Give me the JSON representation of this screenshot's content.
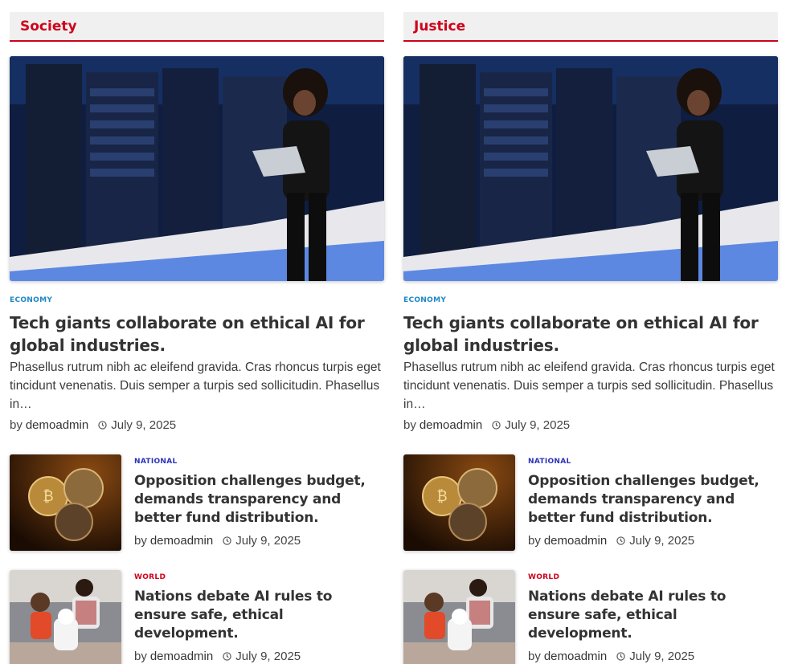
{
  "columns": [
    {
      "section_title": "Society",
      "featured": {
        "category": "ECONOMY",
        "title": "Tech giants collaborate on ethical AI for global industries.",
        "excerpt": "Phasellus rutrum nibh ac eleifend gravida. Cras rhoncus turpis eget tincidunt venenatis. Duis semper a turpis sed sollicitudin. Phasellus in…",
        "by": "by",
        "author": "demoadmin",
        "date": "July 9, 2025"
      },
      "posts": [
        {
          "category": "NATIONAL",
          "title": "Opposition challenges budget, demands transparency and better fund distribution.",
          "by": "by",
          "author": "demoadmin",
          "date": "July 9, 2025"
        },
        {
          "category": "WORLD",
          "title": "Nations debate AI rules to ensure safe, ethical development.",
          "by": "by",
          "author": "demoadmin",
          "date": "July 9, 2025"
        }
      ]
    },
    {
      "section_title": "Justice",
      "featured": {
        "category": "ECONOMY",
        "title": "Tech giants collaborate on ethical AI for global industries.",
        "excerpt": "Phasellus rutrum nibh ac eleifend gravida. Cras rhoncus turpis eget tincidunt venenatis. Duis semper a turpis sed sollicitudin. Phasellus in…",
        "by": "by",
        "author": "demoadmin",
        "date": "July 9, 2025"
      },
      "posts": [
        {
          "category": "NATIONAL",
          "title": "Opposition challenges budget, demands transparency and better fund distribution.",
          "by": "by",
          "author": "demoadmin",
          "date": "July 9, 2025"
        },
        {
          "category": "WORLD",
          "title": "Nations debate AI rules to ensure safe, ethical development.",
          "by": "by",
          "author": "demoadmin",
          "date": "July 9, 2025"
        }
      ]
    }
  ],
  "colors": {
    "accent": "#d0021b",
    "economy": "#1e88c7",
    "national": "#2b33b8",
    "world": "#d0021b"
  },
  "icons": {
    "clock": "clock-icon"
  }
}
